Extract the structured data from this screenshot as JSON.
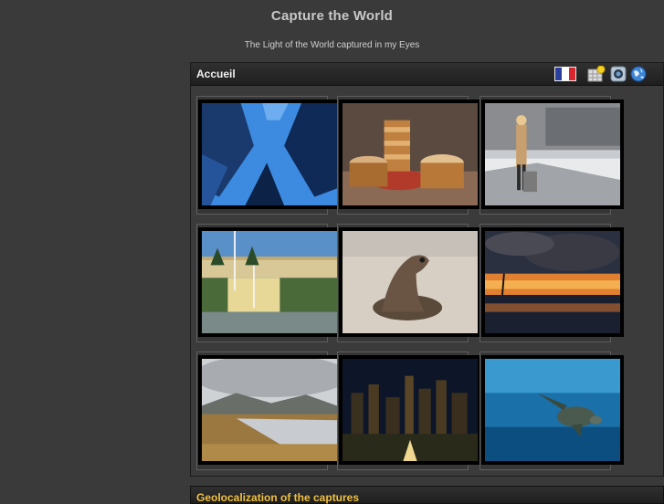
{
  "site": {
    "title": "Capture the World",
    "tagline": "The Light of the World captured in my Eyes"
  },
  "panel": {
    "title": "Accueil",
    "icons": [
      "french-flag-icon",
      "calendar-new-icon",
      "camera-icon",
      "globe-icon"
    ]
  },
  "gallery": {
    "thumbnails": [
      {
        "name": "skyscrapers-photo"
      },
      {
        "name": "dim-sum-steamers-photo"
      },
      {
        "name": "woman-suitcase-street-photo"
      },
      {
        "name": "palace-fountains-photo"
      },
      {
        "name": "sea-lion-photo"
      },
      {
        "name": "sunset-clouds-photo"
      },
      {
        "name": "highland-lake-photo"
      },
      {
        "name": "city-night-photo"
      },
      {
        "name": "sea-turtle-photo"
      }
    ]
  },
  "bottom_panel": {
    "title": "Geolocalization of the captures"
  },
  "colors": {
    "background": "#3a3a3a",
    "header_bar": "#262626",
    "accent_title": "#f0c040"
  }
}
